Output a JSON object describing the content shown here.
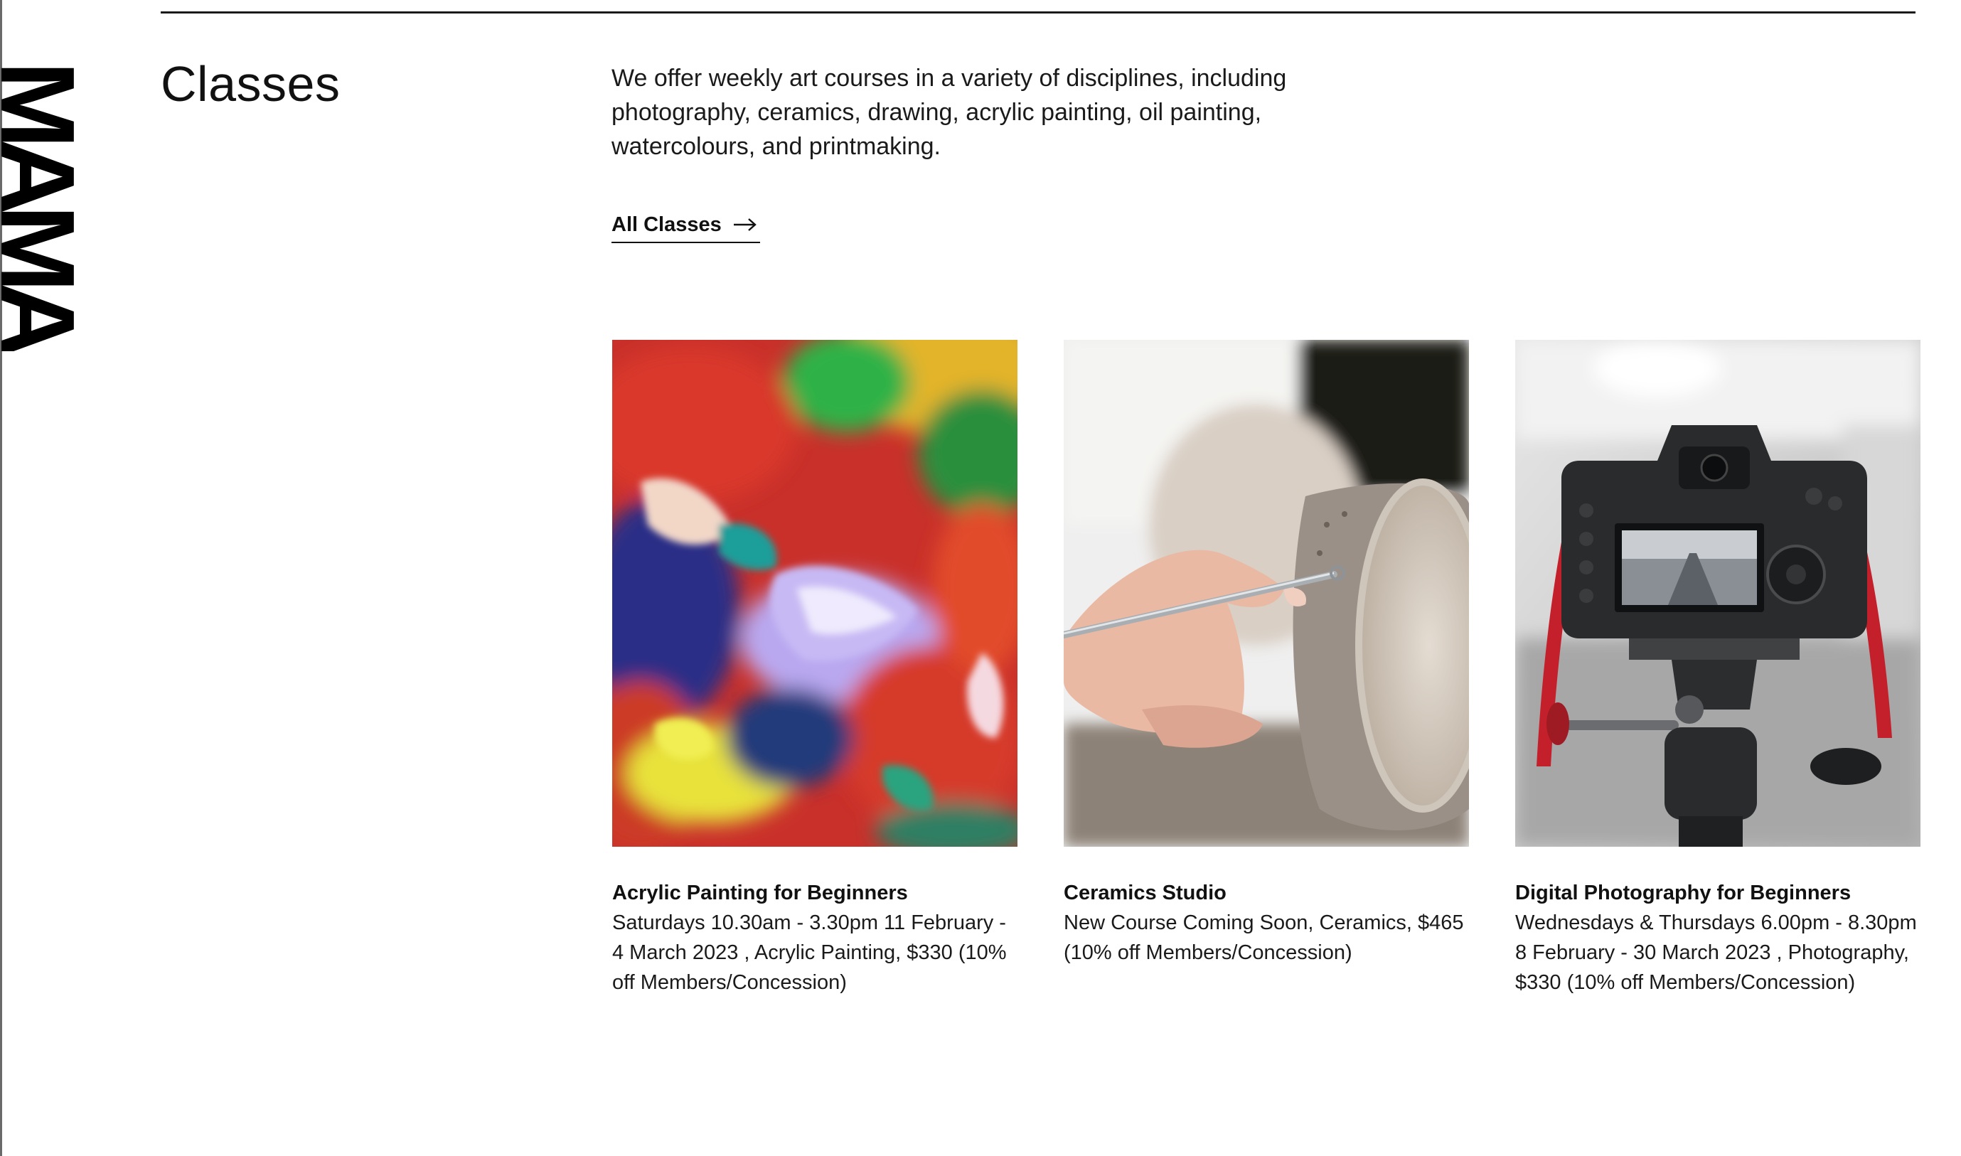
{
  "logo": {
    "text": "MAMA"
  },
  "section": {
    "title": "Classes",
    "intro": "We offer weekly art courses in a variety of disciplines, including photography, ceramics, drawing, acrylic painting, oil painting, watercolours, and printmaking.",
    "all_classes_label": "All Classes",
    "link_icon": "arrow-right-icon"
  },
  "cards": [
    {
      "title": "Acrylic Painting for Beginners",
      "description": "Saturdays 10.30am - 3.30pm 11 February - 4 March 2023 , Acrylic Painting, $330 (10% off Members/Concession)",
      "image": "acrylic-paint-palette-image"
    },
    {
      "title": "Ceramics Studio",
      "description": "New Course Coming Soon, Ceramics, $465 (10% off Members/Concession)",
      "image": "ceramics-carving-image"
    },
    {
      "title": "Digital Photography for Beginners",
      "description": "Wednesdays & Thursdays 6.00pm - 8.30pm 8 February - 30 March 2023 , Photography, $330 (10% off Members/Concession)",
      "image": "camera-on-tripod-image"
    }
  ],
  "colors": {
    "text": "#111111",
    "background": "#ffffff",
    "rule": "#1a1a1a"
  }
}
